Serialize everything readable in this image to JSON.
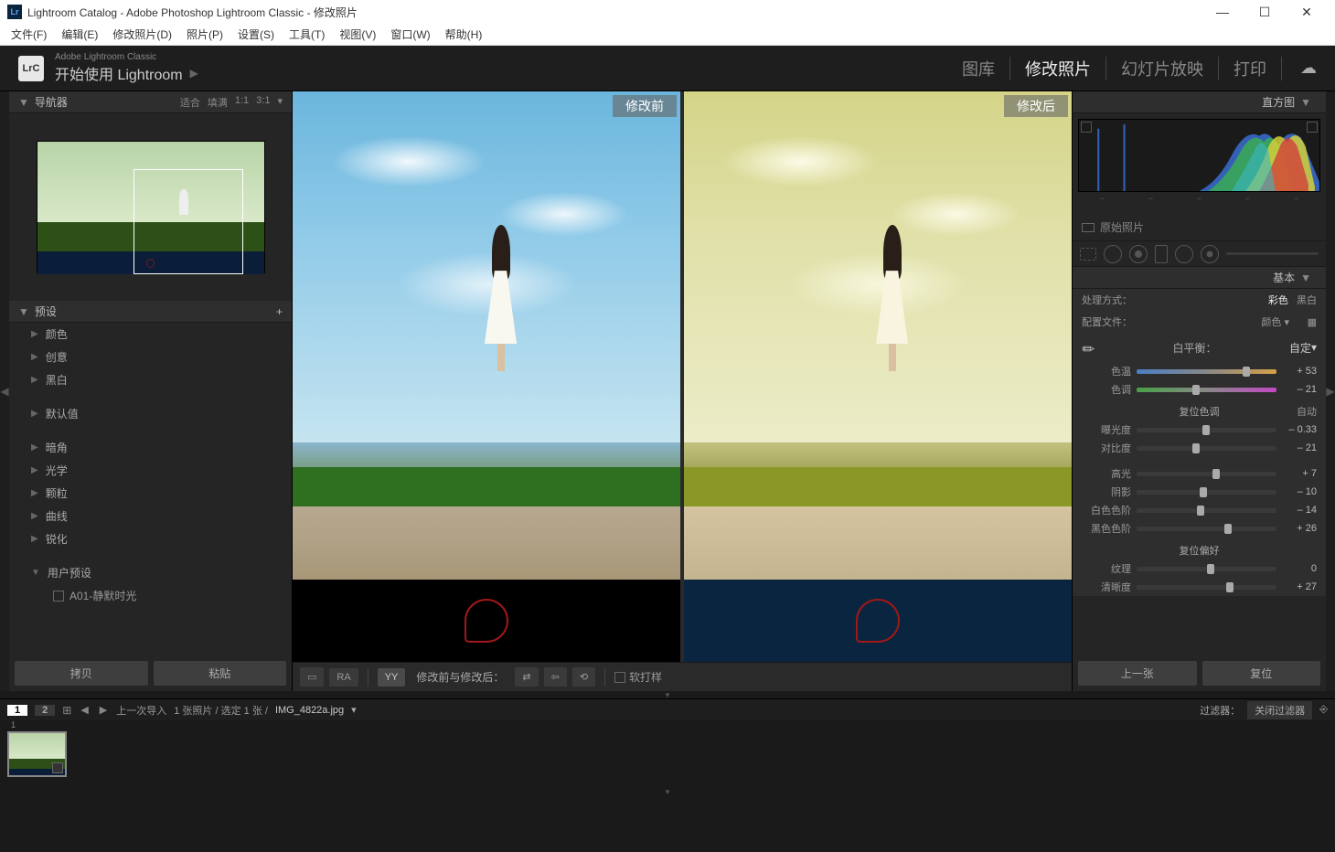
{
  "titlebar": {
    "icon": "Lr",
    "title": "Lightroom Catalog - Adobe Photoshop Lightroom Classic - 修改照片"
  },
  "menus": [
    "文件(F)",
    "编辑(E)",
    "修改照片(D)",
    "照片(P)",
    "设置(S)",
    "工具(T)",
    "视图(V)",
    "窗口(W)",
    "帮助(H)"
  ],
  "header": {
    "logo": "LrC",
    "small": "Adobe Lightroom Classic",
    "big": "开始使用 Lightroom",
    "modules": [
      "图库",
      "修改照片",
      "幻灯片放映",
      "打印"
    ],
    "active_module": "修改照片"
  },
  "navigator": {
    "title": "导航器",
    "zoom": [
      "适合",
      "填满",
      "1:1",
      "3:1"
    ]
  },
  "presets": {
    "title": "预设",
    "groups1": [
      "颜色",
      "创意",
      "黑白"
    ],
    "defaults": "默认值",
    "groups2": [
      "暗角",
      "光学",
      "颗粒",
      "曲线",
      "锐化"
    ],
    "user_presets": "用户预设",
    "user_item": "A01-静默时光"
  },
  "left_buttons": {
    "copy": "拷贝",
    "paste": "粘贴"
  },
  "center": {
    "before": "修改前",
    "after": "修改后",
    "toolbar_label": "修改前与修改后：",
    "softproof": "软打样",
    "ra": "RA",
    "yy": "YY"
  },
  "right": {
    "histogram_title": "直方图",
    "original": "原始照片",
    "basic_title": "基本",
    "treatment": "处理方式：",
    "treat_color": "彩色",
    "treat_bw": "黑白",
    "profile": "配置文件：",
    "profile_val": "颜色",
    "wb_label": "白平衡：",
    "wb_val": "自定",
    "sliders": {
      "temp": {
        "label": "色温",
        "value": "+ 53"
      },
      "tint": {
        "label": "色调",
        "value": "– 21"
      },
      "tone_title": "复位色调",
      "auto": "自动",
      "exposure": {
        "label": "曝光度",
        "value": "– 0.33"
      },
      "contrast": {
        "label": "对比度",
        "value": "– 21"
      },
      "highlights": {
        "label": "高光",
        "value": "+ 7"
      },
      "shadows": {
        "label": "阴影",
        "value": "– 10"
      },
      "whites": {
        "label": "白色色阶",
        "value": "– 14"
      },
      "blacks": {
        "label": "黑色色阶",
        "value": "+ 26"
      },
      "presence_title": "复位偏好",
      "texture": {
        "label": "纹理",
        "value": "0"
      },
      "clarity": {
        "label": "清晰度",
        "value": "+ 27"
      }
    },
    "prev": "上一张",
    "reset": "复位"
  },
  "filmstrip": {
    "page1": "1",
    "page2": "2",
    "last_import": "上一次导入",
    "count": "1 张照片 / 选定 1 张 /",
    "filename": "IMG_4822a.jpg",
    "filter_label": "过滤器：",
    "filter_val": "关闭过滤器"
  }
}
